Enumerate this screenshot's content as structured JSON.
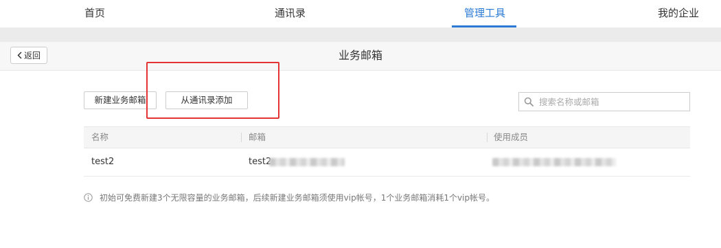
{
  "nav": {
    "items": [
      {
        "label": "首页"
      },
      {
        "label": "通讯录"
      },
      {
        "label": "管理工具"
      },
      {
        "label": "我的企业"
      }
    ]
  },
  "subheader": {
    "back_label": "返回",
    "title": "业务邮箱"
  },
  "toolbar": {
    "new_mailbox_label": "新建业务邮箱",
    "add_from_contacts_label": "从通讯录添加"
  },
  "search": {
    "placeholder": "搜索名称或邮箱"
  },
  "table": {
    "columns": [
      "名称",
      "邮箱",
      "使用成员"
    ],
    "rows": [
      {
        "name": "test2",
        "email": "test2"
      }
    ]
  },
  "notice": {
    "text": "初始可免费新建3个无限容量的业务邮箱，后续新建业务邮箱须使用vip帐号，1个业务邮箱消耗1个vip帐号。"
  },
  "colors": {
    "accent": "#2a7ad5",
    "highlight": "#e33333"
  }
}
